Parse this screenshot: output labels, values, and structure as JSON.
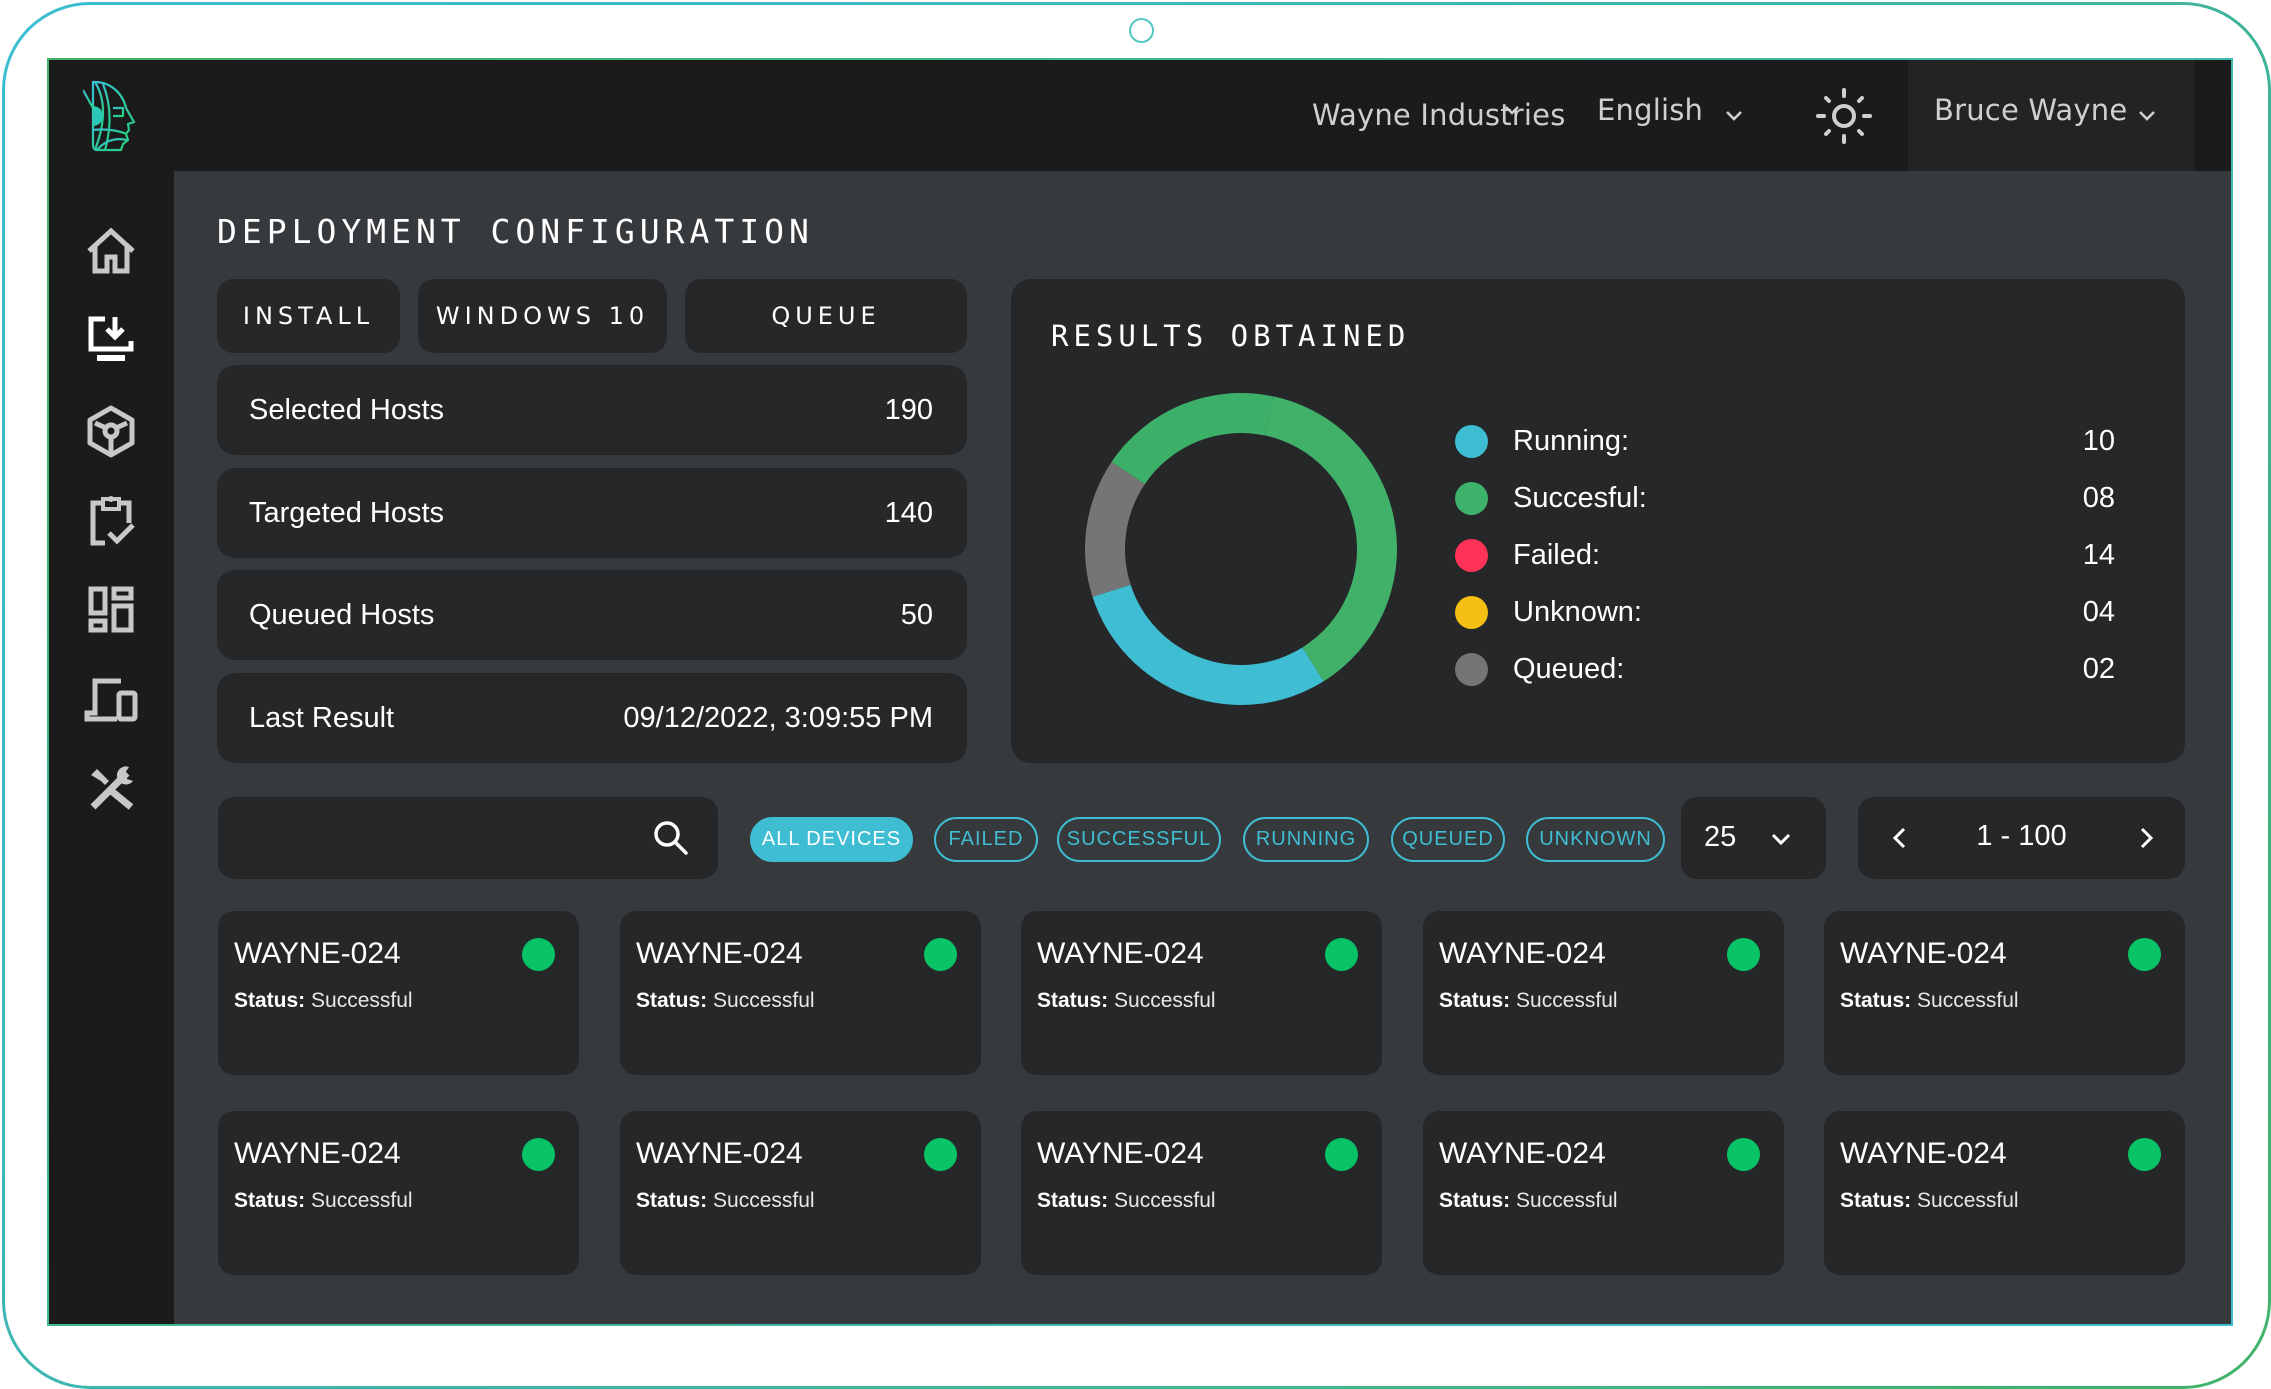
{
  "header": {
    "organization": "Wayne Industries",
    "language": "English",
    "theme_icon": "sun-icon",
    "user_name": "Bruce Wayne"
  },
  "sidebar": {
    "items": [
      {
        "name": "home",
        "icon": "home-icon",
        "active": false
      },
      {
        "name": "deployment",
        "icon": "monitor-download-icon",
        "active": true
      },
      {
        "name": "packages",
        "icon": "cube-icon",
        "active": false
      },
      {
        "name": "tasks",
        "icon": "clipboard-check-icon",
        "active": false
      },
      {
        "name": "dashboard",
        "icon": "dashboard-grid-icon",
        "active": false
      },
      {
        "name": "devices",
        "icon": "devices-icon",
        "active": false
      },
      {
        "name": "tools",
        "icon": "tools-icon",
        "active": false
      }
    ]
  },
  "page": {
    "title": "DEPLOYMENT CONFIGURATION",
    "tags": [
      "INSTALL",
      "WINDOWS 10",
      "QUEUE"
    ],
    "info_rows": [
      {
        "label": "Selected Hosts",
        "value": "190"
      },
      {
        "label": "Targeted Hosts",
        "value": "140"
      },
      {
        "label": "Queued Hosts",
        "value": "50"
      },
      {
        "label": "Last Result",
        "value": "09/12/2022, 3:09:55 PM"
      }
    ]
  },
  "results": {
    "title": "RESULTS OBTAINED",
    "legend": [
      {
        "label": "Running:",
        "value": "10",
        "color": "#3fbdd3"
      },
      {
        "label": "Succesful:",
        "value": "08",
        "color": "#3db26a"
      },
      {
        "label": "Failed:",
        "value": "14",
        "color": "#ff3358"
      },
      {
        "label": "Unknown:",
        "value": "04",
        "color": "#f5bf13"
      },
      {
        "label": "Queued:",
        "value": "02",
        "color": "#767476"
      }
    ]
  },
  "chart_data": {
    "type": "pie",
    "title": "RESULTS OBTAINED",
    "donut": true,
    "start_angle_deg": 12,
    "segments": [
      {
        "name": "green-segment-a",
        "fraction": 0.378,
        "color": "#41b16a"
      },
      {
        "name": "running-segment",
        "fraction": 0.289,
        "color": "#3fbdd3"
      },
      {
        "name": "queued-segment",
        "fraction": 0.144,
        "color": "#767476"
      },
      {
        "name": "green-segment-b",
        "fraction": 0.189,
        "color": "#3cb068"
      }
    ],
    "legend": [
      {
        "label": "Running",
        "value": 10
      },
      {
        "label": "Succesful",
        "value": 8
      },
      {
        "label": "Failed",
        "value": 14
      },
      {
        "label": "Unknown",
        "value": 4
      },
      {
        "label": "Queued",
        "value": 2
      }
    ],
    "legend_position": "right"
  },
  "filters": {
    "search_placeholder": "",
    "search_value": "",
    "chips": [
      {
        "label": "ALL DEVICES",
        "active": true
      },
      {
        "label": "FAILED",
        "active": false
      },
      {
        "label": "SUCCESSFUL",
        "active": false
      },
      {
        "label": "RUNNING",
        "active": false
      },
      {
        "label": "QUEUED",
        "active": false
      },
      {
        "label": "UNKNOWN",
        "active": false
      }
    ],
    "per_page": "25",
    "page_range": "1 - 100"
  },
  "devices": {
    "status_label": "Status:",
    "status_color": "#08c466",
    "items": [
      {
        "name": "WAYNE-024",
        "status": "Successful"
      },
      {
        "name": "WAYNE-024",
        "status": "Successful"
      },
      {
        "name": "WAYNE-024",
        "status": "Successful"
      },
      {
        "name": "WAYNE-024",
        "status": "Successful"
      },
      {
        "name": "WAYNE-024",
        "status": "Successful"
      },
      {
        "name": "WAYNE-024",
        "status": "Successful"
      },
      {
        "name": "WAYNE-024",
        "status": "Successful"
      },
      {
        "name": "WAYNE-024",
        "status": "Successful"
      },
      {
        "name": "WAYNE-024",
        "status": "Successful"
      },
      {
        "name": "WAYNE-024",
        "status": "Successful"
      }
    ]
  }
}
